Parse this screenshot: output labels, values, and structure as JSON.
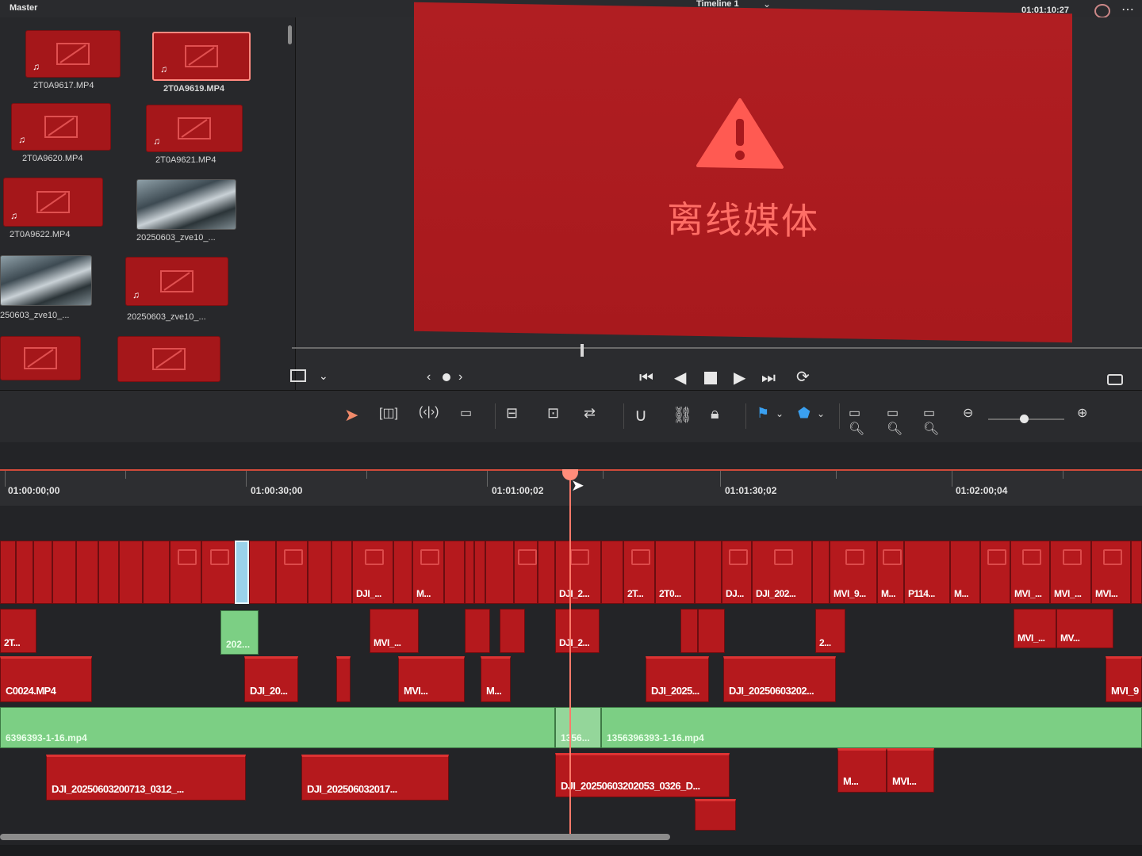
{
  "topbar": {
    "master_label": "Master",
    "timeline_name": "Timeline 1",
    "timecode": "01:01:10:27"
  },
  "media_pool": {
    "clips": [
      {
        "name": "2T0A9617.MP4",
        "kind": "offline-audio"
      },
      {
        "name": "2T0A9619.MP4",
        "kind": "offline-audio",
        "selected": true
      },
      {
        "name": "2T0A9620.MP4",
        "kind": "offline-audio"
      },
      {
        "name": "2T0A9621.MP4",
        "kind": "offline-audio"
      },
      {
        "name": "2T0A9622.MP4",
        "kind": "offline-audio"
      },
      {
        "name": "20250603_zve10_...",
        "kind": "photo"
      },
      {
        "name": "250603_zve10_...",
        "kind": "photo"
      },
      {
        "name": "20250603_zve10_...",
        "kind": "offline-audio"
      },
      {
        "name": "",
        "kind": "offline"
      },
      {
        "name": "",
        "kind": "offline"
      }
    ]
  },
  "viewer": {
    "offline_text": "离线媒体",
    "accent_color": "#b01e22",
    "warn_color": "#ff5a52"
  },
  "ruler": {
    "timecodes": [
      "01:00:00;00",
      "01:00:30;00",
      "01:01:00;02",
      "01:01:30;02",
      "01:02:00;04"
    ]
  },
  "timeline": {
    "v1_labels": [
      "DJI_...",
      "M...",
      "DJI_2...",
      "2T...",
      "2T0...",
      "DJ...",
      "DJI_202...",
      "MVI_9...",
      "M...",
      "P114...",
      "M...",
      "MVI_...",
      "MVI_...",
      "MVI..."
    ],
    "v2_labels": [
      "2T...",
      "202...",
      "MVI_...",
      "DJI_2...",
      "2...",
      "MVI_...",
      "MV..."
    ],
    "v3_labels": [
      "C0024.MP4",
      "DJI_20...",
      "MVI...",
      "M...",
      "DJI_2025...",
      "DJI_20250603202...",
      "MVI_9"
    ],
    "a_green_labels": [
      "6396393-1-16.mp4",
      "1356...",
      "1356396393-1-16.mp4"
    ],
    "a2_labels": [
      "DJI_20250603200713_0312_...",
      "DJI_202506032017...",
      "DJI_20250603202053_0326_D...",
      "M...",
      "MVI..."
    ]
  }
}
